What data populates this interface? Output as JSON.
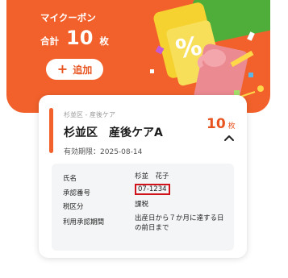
{
  "summary": {
    "coupon_label": "マイクーポン",
    "total_prefix": "合計",
    "total_count": "10",
    "total_unit": "枚",
    "add_label": "追加"
  },
  "card": {
    "subtitle": "杉並区 - 産後ケア",
    "title_ward": "杉並区",
    "title_service": "産後ケアA",
    "expiry_label": "有効期限：",
    "expiry_date": "2025-08-14",
    "count": "10",
    "count_unit": "枚",
    "details": [
      {
        "label": "氏名",
        "value": "杉並　花子"
      },
      {
        "label": "承認番号",
        "value": "07-1234"
      },
      {
        "label": "税区分",
        "value": "課税"
      },
      {
        "label": "利用承認期間",
        "value": "出産日から７か月に達する日の前日まで"
      }
    ]
  },
  "colors": {
    "accent": "#f2612b",
    "highlight_border": "#d0121b"
  }
}
